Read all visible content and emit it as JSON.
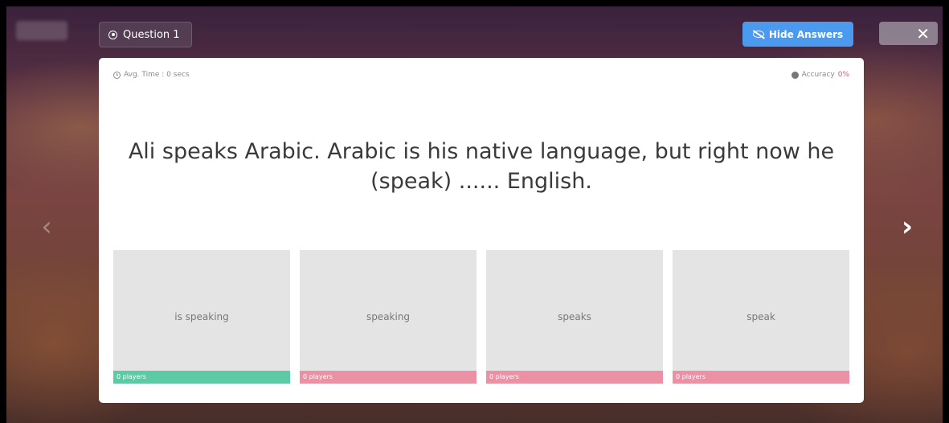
{
  "header": {
    "question_label": "Question 1",
    "hide_answers_label": "Hide Answers",
    "close_symbol": "✕"
  },
  "stats": {
    "avg_time": "Avg. Time : 0 secs",
    "accuracy_label": "Accuracy",
    "accuracy_value": "0%"
  },
  "question": {
    "text": "Ali speaks Arabic. Arabic is his native language, but right now he (speak) ...... English."
  },
  "answers": [
    {
      "label": "is speaking",
      "players": "0 players",
      "status": "correct"
    },
    {
      "label": "speaking",
      "players": "0 players",
      "status": "wrong"
    },
    {
      "label": "speaks",
      "players": "0 players",
      "status": "wrong"
    },
    {
      "label": "speak",
      "players": "0 players",
      "status": "wrong"
    }
  ],
  "nav": {
    "prev_symbol": "‹",
    "next_symbol": "›"
  },
  "colors": {
    "hide_button": "#4a9af0",
    "correct_bar": "#5ccaa5",
    "wrong_bar": "#ec90a6",
    "accuracy_value": "#e8566a"
  },
  "icons": {
    "question": "radio-icon",
    "hide_answers": "eye-slash-icon",
    "avg_time": "clock-icon",
    "accuracy": "target-icon",
    "close": "close-icon",
    "prev": "chevron-left-icon",
    "next": "chevron-right-icon"
  }
}
